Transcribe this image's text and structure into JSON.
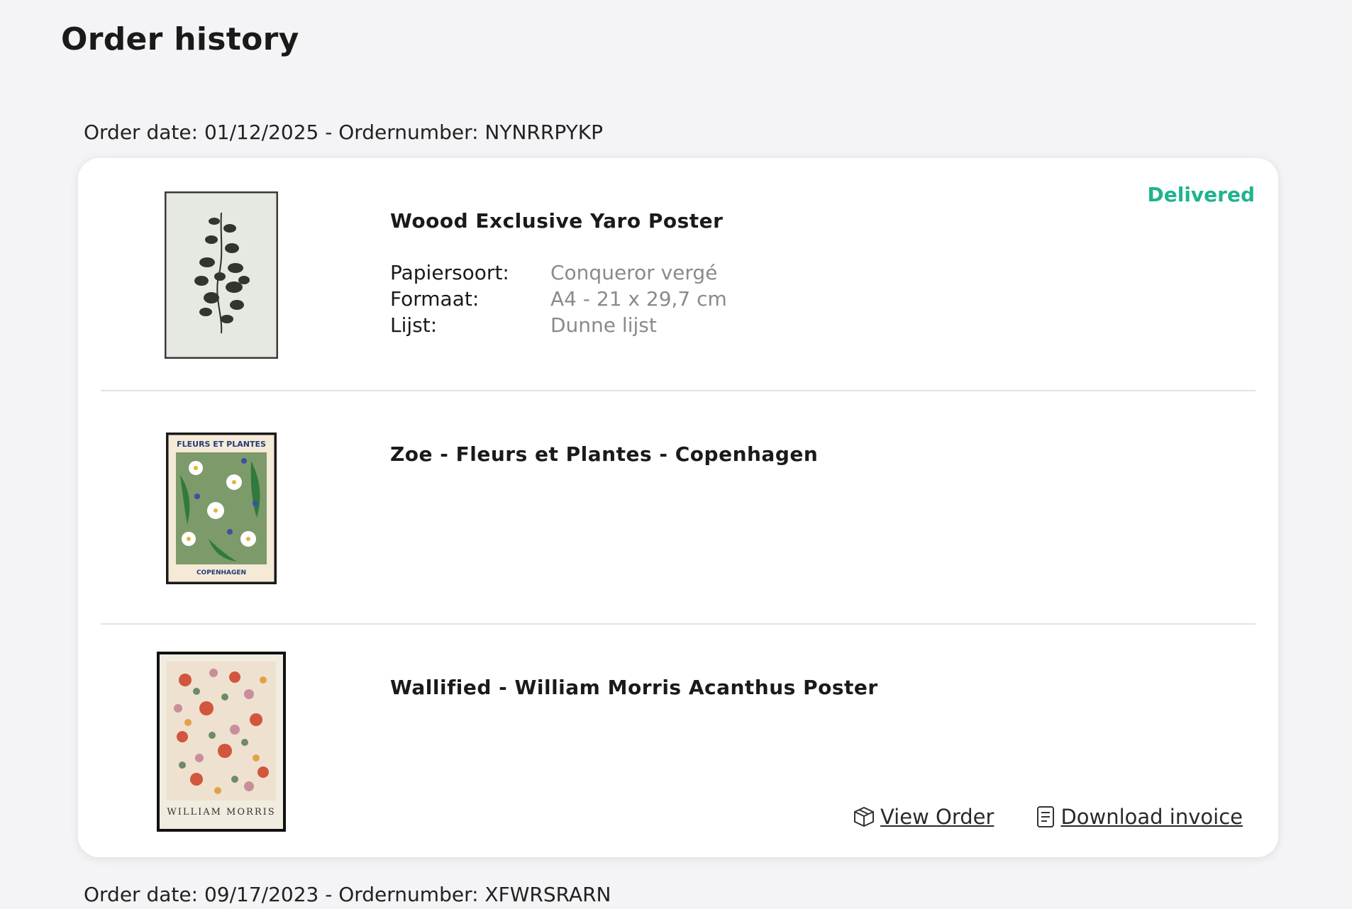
{
  "page": {
    "title": "Order history"
  },
  "orders": [
    {
      "meta": "Order date: 01/12/2025 - Ordernumber: NYNRRPYKP",
      "status": "Delivered",
      "status_color": "#1fb48e",
      "items": [
        {
          "name": "Woood Exclusive Yaro Poster",
          "thumbnail": "eucalyptus-botanical-poster",
          "props": [
            {
              "label": "Papiersoort:",
              "value": "Conqueror vergé"
            },
            {
              "label": "Formaat:",
              "value": "A4 - 21 x 29,7 cm"
            },
            {
              "label": "Lijst:",
              "value": "Dunne lijst"
            }
          ]
        },
        {
          "name": "Zoe - Fleurs et Plantes - Copenhagen",
          "thumbnail": "fleurs-et-plantes-poster",
          "poster_title": "FLEURS ET PLANTES",
          "poster_caption": "COPENHAGEN"
        },
        {
          "name": "Wallified - William Morris Acanthus Poster",
          "thumbnail": "william-morris-floral-poster",
          "poster_caption": "WILLIAM MORRIS"
        }
      ],
      "actions": {
        "view_order": {
          "label": "View Order",
          "icon": "box-icon"
        },
        "download_invoice": {
          "label": "Download invoice",
          "icon": "document-icon"
        }
      }
    },
    {
      "meta": "Order date: 09/17/2023 - Ordernumber: XFWRSRARN"
    }
  ]
}
